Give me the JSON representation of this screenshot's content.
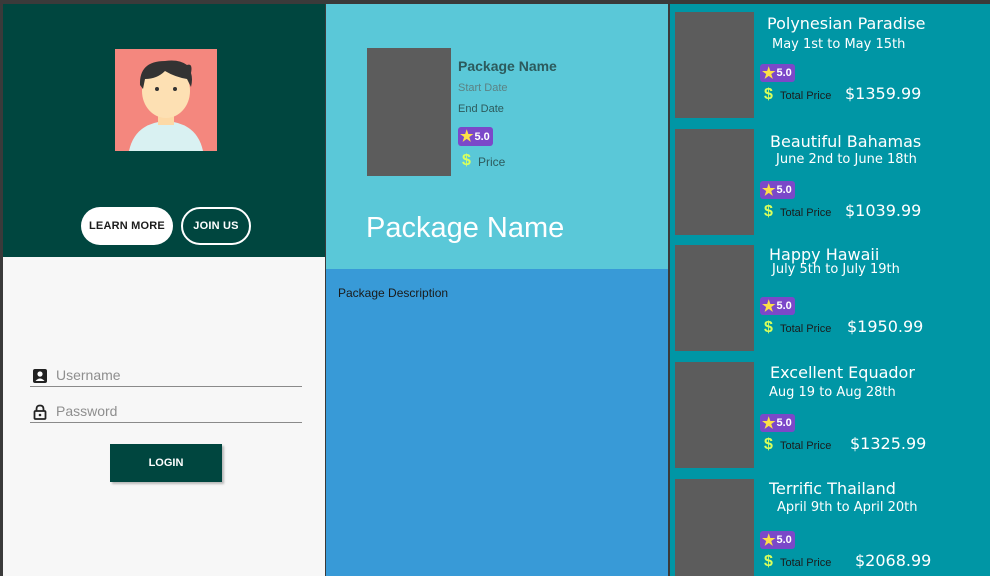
{
  "login": {
    "learn_more": "LEARN MORE",
    "join_us": "JOIN US",
    "username_placeholder": "Username",
    "password_placeholder": "Password",
    "login_button": "LOGIN"
  },
  "detail": {
    "package_name": "Package Name",
    "start_date": "Start Date",
    "end_date": "End Date",
    "rating": "5.0",
    "price_label": "Price",
    "big_package_name": "Package Name",
    "description": "Package Description"
  },
  "list": {
    "total_price_label": "Total Price",
    "items": [
      {
        "name": "Polynesian Paradise",
        "dates": "May 1st to May 15th",
        "rating": "5.0",
        "price": "$1359.99"
      },
      {
        "name": "Beautiful Bahamas",
        "dates": "June 2nd to June 18th",
        "rating": "5.0",
        "price": "$1039.99"
      },
      {
        "name": "Happy Hawaii",
        "dates": "July 5th to July 19th",
        "rating": "5.0",
        "price": "$1950.99"
      },
      {
        "name": "Excellent Equador",
        "dates": "Aug 19 to Aug 28th",
        "rating": "5.0",
        "price": "$1325.99"
      },
      {
        "name": "Terrific Thailand",
        "dates": "April 9th to April 20th",
        "rating": "5.0",
        "price": "$2068.99"
      }
    ]
  },
  "icons": {
    "avatar": "person-avatar",
    "username": "account-box-icon",
    "password": "lock-icon",
    "rating": "star-icon",
    "price": "dollar-icon"
  },
  "colors": {
    "login_hero": "#00463f",
    "detail_header": "#5ac8d8",
    "detail_body": "#389ad7",
    "list_bg": "#0096a5",
    "rating_badge": "#7b48c9",
    "dollar": "#d8ff5c"
  }
}
